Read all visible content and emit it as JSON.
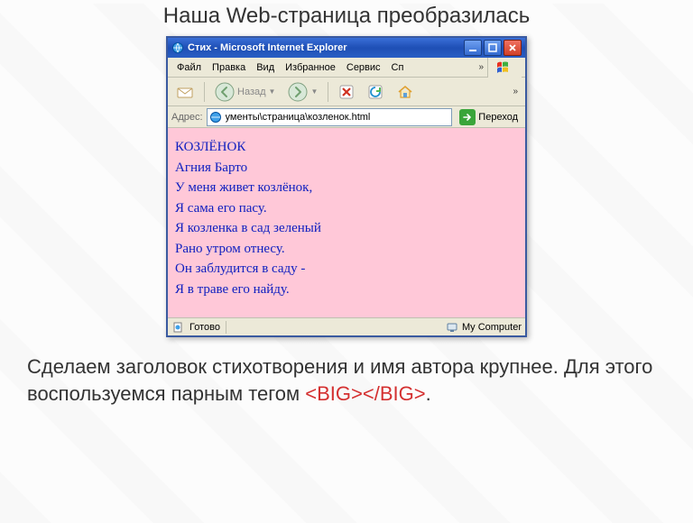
{
  "heading": "Наша Web-страница преобразилась",
  "window": {
    "title": "Стих - Microsoft Internet Explorer",
    "menu": {
      "file": "Файл",
      "edit": "Правка",
      "view": "Вид",
      "favorites": "Избранное",
      "tools": "Сервис",
      "help_abbr": "Сп"
    },
    "toolbar": {
      "back_label": "Назад"
    },
    "addressbar": {
      "label": "Адрес:",
      "value": "ументы\\страница\\козленок.html",
      "go_label": "Переход"
    },
    "content": {
      "title": "КОЗЛЁНОК",
      "author": "Агния Барто",
      "lines": [
        "У меня живет козлёнок,",
        "Я сама его пасу.",
        "Я козленка в сад зеленый",
        "Рано утром отнесу.",
        "Он заблудится в саду -",
        "Я в траве его найду."
      ]
    },
    "statusbar": {
      "status": "Готово",
      "zone": "My Computer"
    }
  },
  "caption": {
    "text_before": "Сделаем заголовок стихотворения и имя автора крупнее. Для этого воспользуемся парным тегом ",
    "tag": "<BIG></BIG>",
    "text_after": "."
  }
}
